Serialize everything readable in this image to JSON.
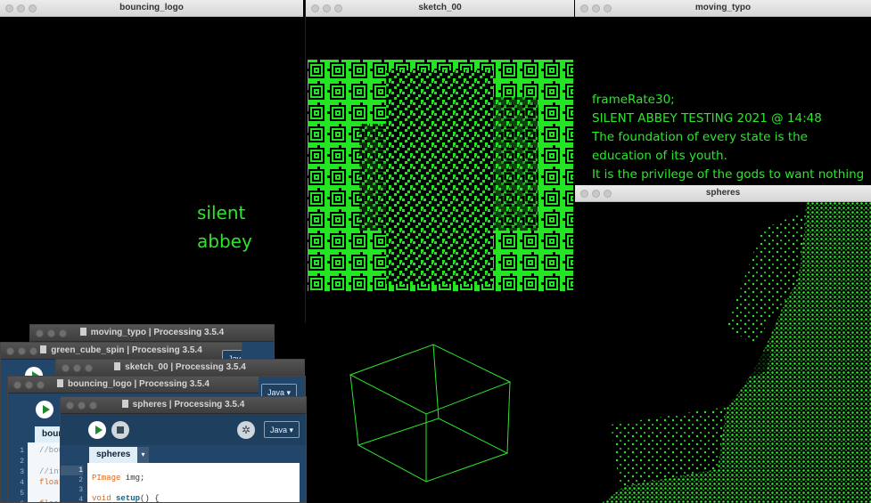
{
  "windows": {
    "bouncing_logo": {
      "title": "bouncing_logo",
      "text_line1": "silent",
      "text_line2": "abbey"
    },
    "sketch_00": {
      "title": "sketch_00"
    },
    "moving_typo": {
      "title": "moving_typo",
      "lines": [
        "frameRate30;",
        "SILENT ABBEY TESTING 2021 @ 14:48",
        "The foundation of every state is the",
        "education of its youth.",
        "It is the privilege of the gods to want nothing"
      ]
    },
    "spheres": {
      "title": "spheres"
    }
  },
  "editors": {
    "moving_typo": {
      "title": "moving_typo | Processing 3.5.4"
    },
    "green_cube_spin": {
      "title": "green_cube_spin | Processing 3.5.4",
      "mode": "Java ▾"
    },
    "sketch_00": {
      "title": "sketch_00 | Processing 3.5.4"
    },
    "bouncing_logo": {
      "title": "bouncing_logo | Processing 3.5.4",
      "mode": "Java ▾",
      "tab": "boun",
      "line_numbers": [
        "1",
        "2",
        "3",
        "4",
        "5",
        "6"
      ],
      "code_fragments": [
        "//bou",
        "//int",
        "float",
        "float"
      ]
    },
    "spheres": {
      "title": "spheres | Processing 3.5.4",
      "mode": "Java ▾",
      "tab": "spheres",
      "tab_arrow": "▾",
      "line_numbers": [
        "1",
        "2",
        "3",
        "4"
      ],
      "code": {
        "line1_type": "PImage",
        "line1_rest": " img;",
        "line3_kw": "void",
        "line3_fn": "setup",
        "line3_rest": "() {"
      }
    }
  },
  "colors": {
    "accent_green": "#2ce62c",
    "editor_blue": "#22456a"
  }
}
